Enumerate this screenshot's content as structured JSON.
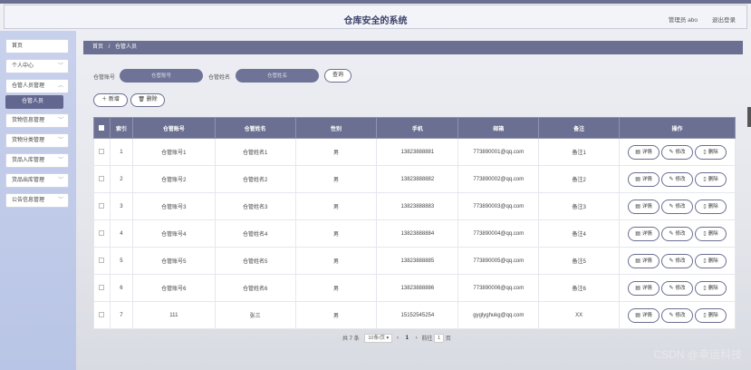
{
  "header": {
    "title": "仓库安全的系统",
    "user_label": "管理员 abo",
    "logout_label": "退出登录"
  },
  "sidebar": {
    "items": [
      {
        "label": "首页",
        "has_chevron": false
      },
      {
        "label": "个人中心",
        "has_chevron": true
      },
      {
        "label": "仓管人员管理",
        "has_chevron": true
      },
      {
        "label": "货物信息管理",
        "has_chevron": true
      },
      {
        "label": "货物分类管理",
        "has_chevron": true
      },
      {
        "label": "货品入库管理",
        "has_chevron": true
      },
      {
        "label": "货品出库管理",
        "has_chevron": true
      },
      {
        "label": "公告信息管理",
        "has_chevron": true
      }
    ],
    "active_sub": "仓管人员"
  },
  "breadcrumb": {
    "home": "首页",
    "sep": "/",
    "current": "仓管人员"
  },
  "search": {
    "account_label": "仓管账号",
    "account_placeholder": "仓管账号",
    "name_label": "仓管姓名",
    "name_placeholder": "仓管姓名",
    "query_label": "查询"
  },
  "actions": {
    "add_label": "新增",
    "delete_label": "删除"
  },
  "table": {
    "headers": [
      "",
      "索引",
      "仓管账号",
      "仓管姓名",
      "性别",
      "手机",
      "邮箱",
      "备注",
      "操作"
    ],
    "rows": [
      {
        "idx": "1",
        "account": "仓管账号1",
        "name": "仓管姓名1",
        "gender": "男",
        "phone": "13823888881",
        "email": "773890001@qq.com",
        "note": "备注1"
      },
      {
        "idx": "2",
        "account": "仓管账号2",
        "name": "仓管姓名2",
        "gender": "男",
        "phone": "13823888882",
        "email": "773890002@qq.com",
        "note": "备注2"
      },
      {
        "idx": "3",
        "account": "仓管账号3",
        "name": "仓管姓名3",
        "gender": "男",
        "phone": "13823888883",
        "email": "773890003@qq.com",
        "note": "备注3"
      },
      {
        "idx": "4",
        "account": "仓管账号4",
        "name": "仓管姓名4",
        "gender": "男",
        "phone": "13823888884",
        "email": "773890004@qq.com",
        "note": "备注4"
      },
      {
        "idx": "5",
        "account": "仓管账号5",
        "name": "仓管姓名5",
        "gender": "男",
        "phone": "13823888885",
        "email": "773890005@qq.com",
        "note": "备注5"
      },
      {
        "idx": "6",
        "account": "仓管账号6",
        "name": "仓管姓名6",
        "gender": "男",
        "phone": "13823888886",
        "email": "773890006@qq.com",
        "note": "备注6"
      },
      {
        "idx": "7",
        "account": "111",
        "name": "张三",
        "gender": "男",
        "phone": "15152545254",
        "email": "gyglyghukg@qq.com",
        "note": "XX"
      }
    ],
    "op_labels": {
      "detail": "详情",
      "edit": "修改",
      "delete": "删除"
    }
  },
  "pager": {
    "total": "共 7 条",
    "page_size": "10条/页",
    "current_page": "1",
    "goto_label": "前往",
    "goto_value": "1",
    "page_unit": "页"
  },
  "watermark": "CSDN @幸运科技",
  "colors": {
    "accent": "#6b6f91",
    "sidebar": "#c8d1ec"
  }
}
